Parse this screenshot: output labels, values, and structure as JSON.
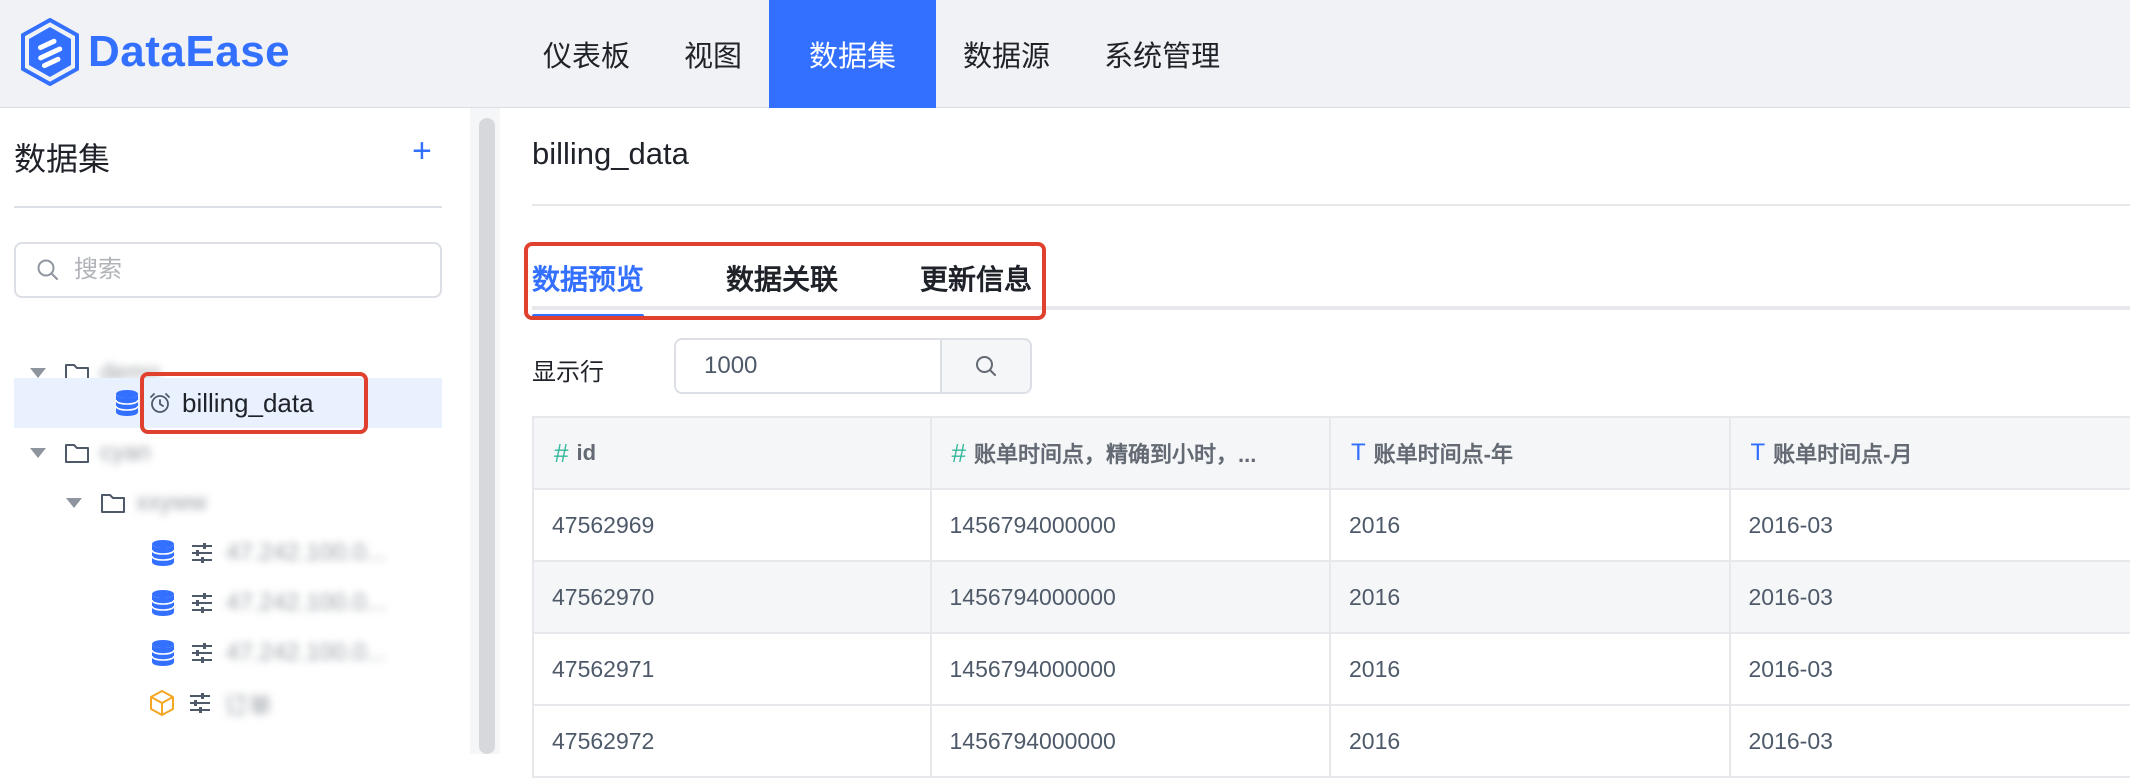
{
  "header": {
    "logo_text": "DataEase",
    "nav": [
      "仪表板",
      "视图",
      "数据集",
      "数据源",
      "系统管理"
    ],
    "active_nav": "数据集",
    "brand_color": "#3370ff"
  },
  "sidebar": {
    "title": "数据集",
    "add_icon": "plus-icon",
    "search_placeholder": "搜索",
    "tree": {
      "group1_label": "demo",
      "selected_label": "billing_data",
      "group2_label": "cyan",
      "subgroup_label": "xxyww",
      "leaf1": "47.242.100.0...",
      "leaf2": "47.242.100.0...",
      "leaf3": "47.242.100.0...",
      "leaf4": "订单"
    }
  },
  "main": {
    "title": "billing_data",
    "tabs": [
      "数据预览",
      "数据关联",
      "更新信息"
    ],
    "rows_label": "显示行",
    "rows_value": "1000",
    "columns": [
      {
        "type_icon": "#",
        "name": "id"
      },
      {
        "type_icon": "#",
        "name": "账单时间点，精确到小时，..."
      },
      {
        "type_icon": "T",
        "name": "账单时间点-年"
      },
      {
        "type_icon": "T",
        "name": "账单时间点-月"
      }
    ],
    "rows": [
      [
        "47562969",
        "1456794000000",
        "2016",
        "2016-03"
      ],
      [
        "47562970",
        "1456794000000",
        "2016",
        "2016-03"
      ],
      [
        "47562971",
        "1456794000000",
        "2016",
        "2016-03"
      ],
      [
        "47562972",
        "1456794000000",
        "2016",
        "2016-03"
      ]
    ]
  },
  "highlight_color": "#e0412f"
}
